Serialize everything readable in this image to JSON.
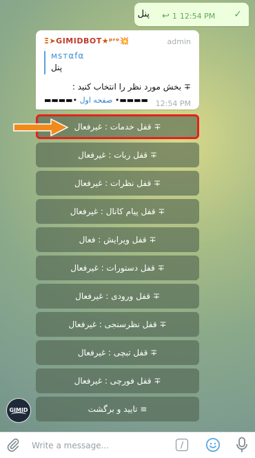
{
  "outgoing": {
    "text": "پنل",
    "reply_count": "1",
    "time": "12:54 PM",
    "reply_icon": "reply-arrow-icon",
    "check_icon": "checkmark-icon"
  },
  "incoming": {
    "sender": "GIMIDBOT",
    "sender_prefix": "Ξ➤",
    "sender_suffix": "★ᵖʳᵒ💥",
    "admin_tag": "admin",
    "quote_name": "ᴍѕтαfα",
    "quote_text": "پنل",
    "text": "∓ بخش مورد نظر را انتخاب کنید :",
    "link_label": "صفحه اول",
    "link_prefix": "▬▬▬▬•",
    "link_suffix": "•▬▬▬▬",
    "time": "12:54 PM"
  },
  "keyboard": {
    "buttons": [
      "∓ قفل خدمات : غیرفعال",
      "∓ قفل ربات : غیرفعال",
      "∓ قفل نظرات : غیرفعال",
      "∓ قفل پیام کانال : غیرفعال",
      "∓ قفل ویرایش : فعال",
      "∓ قفل دستورات : غیرفعال",
      "∓ قفل ورودی : غیرفعال",
      "∓ قفل نظرسنجی : غیرفعال",
      "∓ قفل تبچی : غیرفعال",
      "∓ قفل فورچی : غیرفعال",
      "≡ تایید و برگشت"
    ]
  },
  "avatar": {
    "label": "GIMID"
  },
  "composer": {
    "placeholder": "Write a message...",
    "icons": [
      "attach-icon",
      "bot-command-icon",
      "emoji-icon",
      "microphone-icon"
    ]
  },
  "colors": {
    "outgoing_bubble": "#eeffde",
    "link": "#2f86c7",
    "highlight": "#e3231b",
    "arrow": "#f08a1c"
  }
}
